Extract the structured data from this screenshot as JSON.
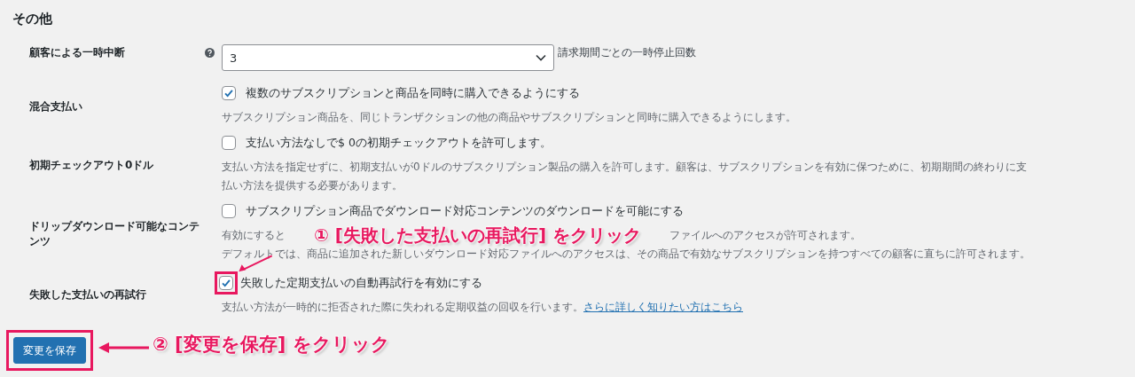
{
  "section_title": "その他",
  "settings": [
    {
      "kind": "select",
      "label": "顧客による一時中断",
      "help": true,
      "value": "3",
      "suffix": "請求期間ごとの一時停止回数"
    },
    {
      "kind": "checkbox",
      "label": "混合支払い",
      "checked": true,
      "text": "複数のサブスクリプションと商品を同時に購入できるようにする",
      "description": [
        "サブスクリプション商品を、同じトランザクションの他の商品やサブスクリプションと同時に購入できるようにします。"
      ]
    },
    {
      "kind": "checkbox",
      "label": "初期チェックアウト0ドル",
      "checked": false,
      "text": "支払い方法なしで$ 0の初期チェックアウトを許可します。",
      "description": [
        "支払い方法を指定せずに、初期支払いが0ドルのサブスクリプション製品の購入を許可します。顧客は、サブスクリプションを有効に保つために、初期期間の終わりに支",
        "払い方法を提供する必要があります。"
      ]
    },
    {
      "kind": "checkbox",
      "label": "ドリップダウンロード可能なコンテンツ",
      "checked": false,
      "text": "サブスクリプション商品でダウンロード対応コンテンツのダウンロードを可能にする",
      "description_parts": [
        "有効にすると",
        "ファイルへのアクセスが許可されます。"
      ],
      "description": [
        "デフォルトでは、商品に追加された新しいダウンロード対応ファイルへのアクセスは、その商品で有効なサブスクリプションを持つすべての顧客に直ちに許可されます。"
      ]
    },
    {
      "kind": "checkbox",
      "label": "失敗した支払いの再試行",
      "checked": true,
      "highlighted": true,
      "text": "失敗した定期支払いの自動再試行を有効にする",
      "description": [
        "支払い方法が一時的に拒否された際に失われる定期収益の回収を行います。"
      ],
      "link": "さらに詳しく知りたい方はこちら"
    }
  ],
  "save_button": {
    "label": "変更を保存",
    "highlighted": true
  },
  "annotations": [
    {
      "kind": "checkbox",
      "text": "① [失敗した支払いの再試行] をクリック"
    },
    {
      "kind": "save",
      "text": "② [変更を保存] をクリック"
    }
  ]
}
